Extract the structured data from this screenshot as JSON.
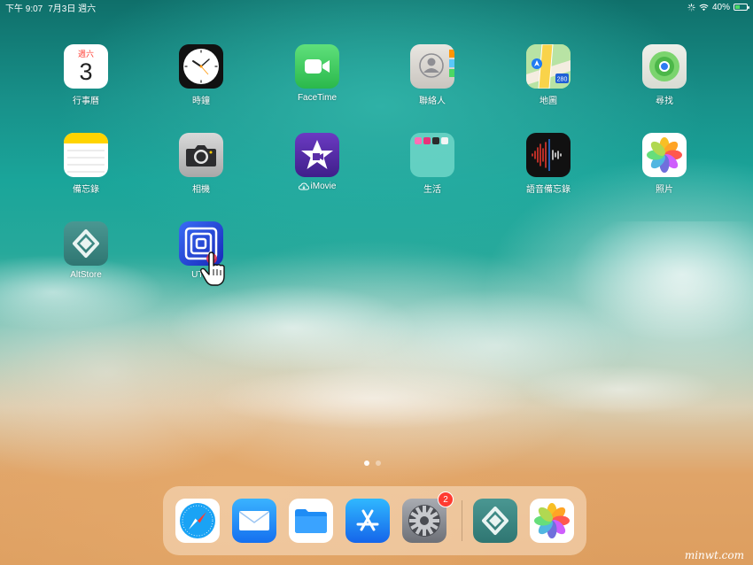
{
  "status_bar": {
    "time": "下午 9:07",
    "date": "7月3日 週六",
    "battery_percent": "40%",
    "battery_level": 0.4,
    "icons": [
      "loading-spinner-icon",
      "wifi-icon",
      "battery-icon"
    ]
  },
  "home_apps": [
    {
      "id": "calendar",
      "label": "行事曆",
      "icon": "calendar-icon",
      "weekday": "週六",
      "day": "3"
    },
    {
      "id": "clock",
      "label": "時鐘",
      "icon": "clock-icon"
    },
    {
      "id": "facetime",
      "label": "FaceTime",
      "icon": "facetime-icon"
    },
    {
      "id": "contacts",
      "label": "聯絡人",
      "icon": "contacts-icon"
    },
    {
      "id": "maps",
      "label": "地圖",
      "icon": "maps-icon",
      "route_number": "280"
    },
    {
      "id": "findmy",
      "label": "尋找",
      "icon": "find-my-icon"
    },
    {
      "id": "notes",
      "label": "備忘錄",
      "icon": "notes-icon"
    },
    {
      "id": "camera",
      "label": "相機",
      "icon": "camera-icon"
    },
    {
      "id": "imovie",
      "label": "iMovie",
      "icon": "imovie-icon"
    },
    {
      "id": "lifestyle-folder",
      "label": "生活",
      "icon": "folder-icon"
    },
    {
      "id": "voice-memos",
      "label": "語音備忘錄",
      "icon": "voice-memos-icon"
    },
    {
      "id": "photos",
      "label": "照片",
      "icon": "photos-icon"
    },
    {
      "id": "altstore",
      "label": "AltStore",
      "icon": "altstore-icon"
    },
    {
      "id": "utm",
      "label": "UTM",
      "icon": "utm-icon"
    }
  ],
  "dock_apps": [
    {
      "id": "safari",
      "icon": "safari-icon"
    },
    {
      "id": "mail",
      "icon": "mail-icon"
    },
    {
      "id": "files",
      "icon": "files-icon"
    },
    {
      "id": "app-store",
      "icon": "app-store-icon"
    },
    {
      "id": "settings",
      "icon": "settings-icon",
      "badge": "2"
    },
    {
      "id": "altstore-dock",
      "icon": "altstore-icon"
    },
    {
      "id": "photos-dock",
      "icon": "photos-icon"
    }
  ],
  "page_indicator": {
    "current": 1,
    "total": 2
  },
  "watermark": "minwt.com",
  "colors": {
    "calendar_red": "#ff3b30",
    "facetime_green": "#34c759",
    "imovie_purple": "#5b2fa8",
    "utm_blue": "#1b3fd1",
    "altstore_teal": "#3f8a86"
  }
}
